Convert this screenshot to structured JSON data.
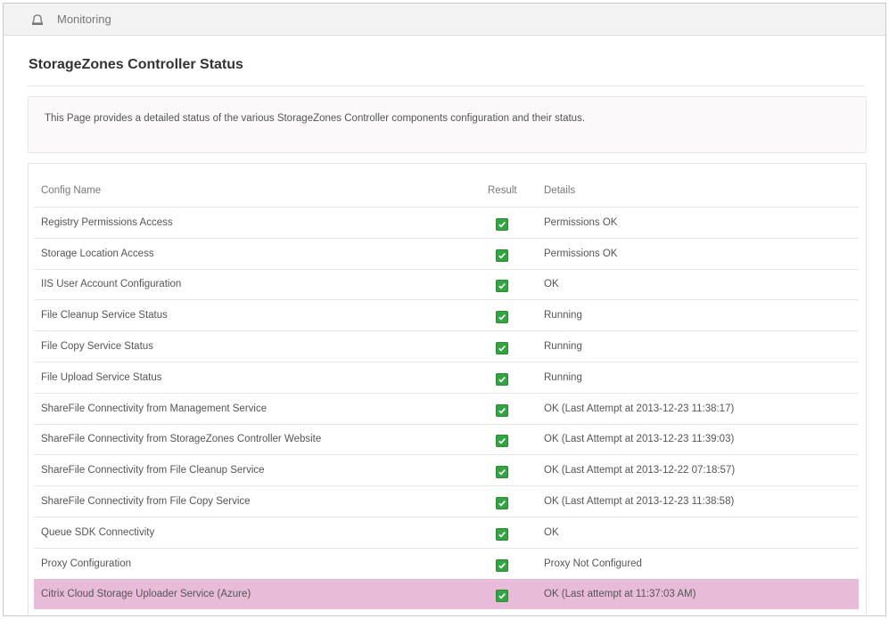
{
  "breadcrumb": {
    "icon": "bell-icon",
    "label": "Monitoring"
  },
  "page_title": "StorageZones Controller Status",
  "info_text": "This Page provides a detailed status of the various StorageZones Controller components configuration and their status.",
  "table": {
    "headers": {
      "name": "Config Name",
      "result": "Result",
      "details": "Details"
    },
    "rows": [
      {
        "name": "Registry Permissions Access",
        "result": "check-icon",
        "details": "Permissions OK"
      },
      {
        "name": "Storage Location Access",
        "result": "check-icon",
        "details": "Permissions OK"
      },
      {
        "name": "IIS User Account Configuration",
        "result": "check-icon",
        "details": "OK"
      },
      {
        "name": "File Cleanup Service Status",
        "result": "check-icon",
        "details": "Running"
      },
      {
        "name": "File Copy Service Status",
        "result": "check-icon",
        "details": "Running"
      },
      {
        "name": "File Upload Service Status",
        "result": "check-icon",
        "details": "Running"
      },
      {
        "name": "ShareFile Connectivity from Management Service",
        "result": "check-icon",
        "details": "OK (Last Attempt at 2013-12-23 11:38:17)"
      },
      {
        "name": "ShareFile Connectivity from StorageZones Controller Website",
        "result": "check-icon",
        "details": "OK (Last Attempt at 2013-12-23 11:39:03)"
      },
      {
        "name": "ShareFile Connectivity from File Cleanup Service",
        "result": "check-icon",
        "details": "OK (Last Attempt at 2013-12-22 07:18:57)"
      },
      {
        "name": "ShareFile Connectivity from File Copy Service",
        "result": "check-icon",
        "details": "OK (Last Attempt at 2013-12-23 11:38:58)"
      },
      {
        "name": "Queue SDK Connectivity",
        "result": "check-icon",
        "details": "OK"
      },
      {
        "name": "Proxy Configuration",
        "result": "check-icon",
        "details": "Proxy Not Configured"
      },
      {
        "name": "Citrix Cloud Storage Uploader Service (Azure)",
        "result": "check-icon",
        "details": "OK (Last attempt at 11:37:03 AM)",
        "highlighted": true
      }
    ]
  },
  "colors": {
    "highlight_row": "#e8bbd9",
    "check_green": "#33a442"
  }
}
